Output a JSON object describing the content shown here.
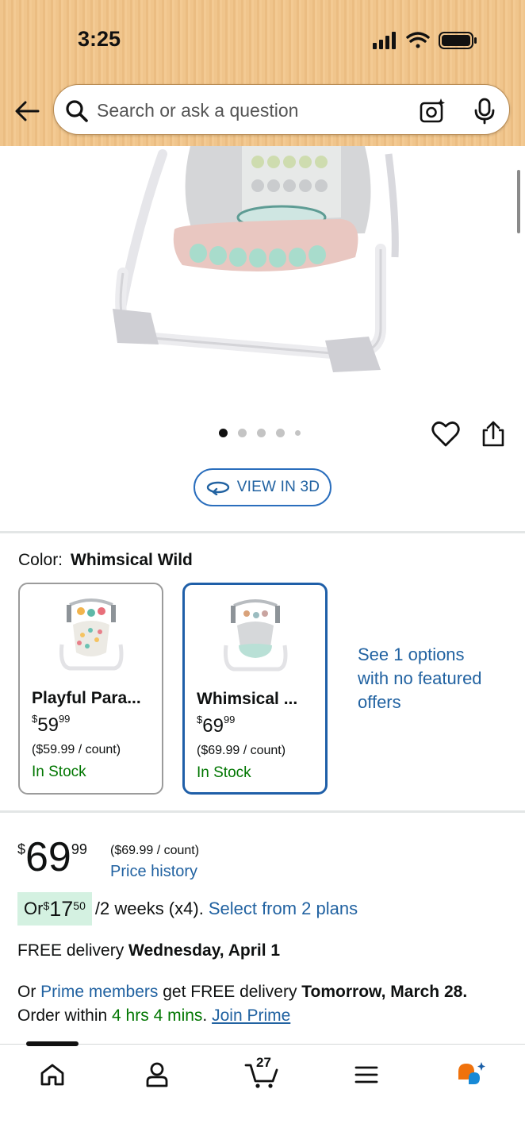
{
  "status_bar": {
    "time": "3:25"
  },
  "header": {
    "search_placeholder": "Search or ask a question"
  },
  "product_image": {
    "dot_count": 5,
    "active_dot": 0,
    "view_3d_label": "VIEW IN 3D"
  },
  "color_section": {
    "label": "Color:",
    "selected_value": "Whimsical Wild",
    "options": [
      {
        "name": "Playful Para...",
        "price_symbol": "$",
        "price_whole": "59",
        "price_fraction": "99",
        "unit_price": "($59.99 / count)",
        "stock": "In Stock",
        "selected": false
      },
      {
        "name": "Whimsical ...",
        "price_symbol": "$",
        "price_whole": "69",
        "price_fraction": "99",
        "unit_price": "($69.99 / count)",
        "stock": "In Stock",
        "selected": true
      }
    ],
    "see_options": "See 1 options with no featured offers"
  },
  "price": {
    "symbol": "$",
    "whole": "69",
    "fraction": "99",
    "unit_price": "($69.99 / count)",
    "history_link": "Price history"
  },
  "installment": {
    "prefix": "Or ",
    "symbol": "$",
    "whole": "17",
    "fraction": "50",
    "rest": "/2 weeks (x4).",
    "link": "Select from 2 plans"
  },
  "delivery": {
    "prefix": "FREE delivery ",
    "date": "Wednesday, April 1"
  },
  "prime": {
    "or": "Or ",
    "members_link": "Prime members",
    "middle": " get FREE delivery ",
    "date": "Tomorrow, March 28.",
    "order_within": "Order within ",
    "countdown": "4 hrs 4 mins",
    "period": ". ",
    "join_link": "Join Prime"
  },
  "bottom_nav": {
    "cart_count": "27",
    "items": [
      "home-icon",
      "account-icon",
      "cart-icon",
      "menu-icon",
      "rufus-icon"
    ]
  },
  "colors": {
    "link": "#2162a1",
    "in_stock": "#007600",
    "selected_border": "#1f5fa8",
    "installment_highlight": "#d4f1e1",
    "header_bg": "#f0c58c"
  }
}
